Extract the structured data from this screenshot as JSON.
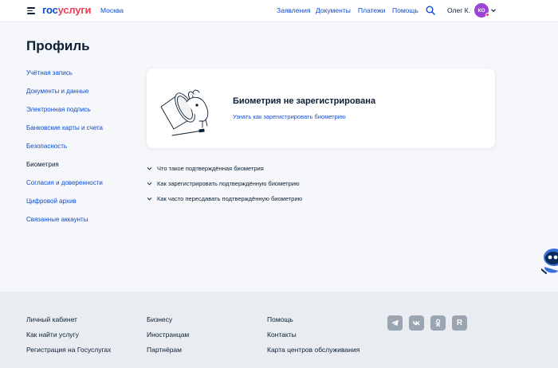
{
  "header": {
    "logo_gos": "гос",
    "logo_uslugi": "услуги",
    "city": "Москва",
    "nav": [
      "Заявления",
      "Документы",
      "Платежи",
      "Помощь"
    ],
    "user_name": "Олег К.",
    "avatar_initials": "КО"
  },
  "page": {
    "title": "Профиль"
  },
  "sidebar": {
    "items": [
      {
        "label": "Учётная запись"
      },
      {
        "label": "Документы и данные"
      },
      {
        "label": "Электронная подпись"
      },
      {
        "label": "Банковские карты и счета"
      },
      {
        "label": "Безопасность"
      },
      {
        "label": "Биометрия",
        "active": true
      },
      {
        "label": "Согласия и доверенности"
      },
      {
        "label": "Цифровой архив"
      },
      {
        "label": "Связанные аккаунты"
      }
    ]
  },
  "card": {
    "title": "Биометрия не зарегистрирована",
    "link": "Узнать как зарегистрировать биометрию"
  },
  "faq": [
    {
      "label": "Что такое подтверждённая биометрия"
    },
    {
      "label": "Как зарегистрировать подтверждённую биометрию"
    },
    {
      "label": "Как часто пересдавать подтверждённую биометрию"
    }
  ],
  "footer": {
    "col1": [
      "Личный кабинет",
      "Как найти услугу",
      "Регистрация на Госуслугах"
    ],
    "col2": [
      "Бизнесу",
      "Иностранцам",
      "Партнёрам"
    ],
    "col3": [
      "Помощь",
      "Контакты",
      "Карта центров обслуживания"
    ],
    "social": [
      {
        "icon": "telegram-icon"
      },
      {
        "icon": "vk-icon"
      },
      {
        "icon": "odnoklassniki-icon"
      },
      {
        "icon": "rutube-icon",
        "letter": "R"
      }
    ]
  },
  "colors": {
    "brand_blue": "#0d4cd3",
    "brand_red": "#ee3f58",
    "avatar_purple": "#9b45d8",
    "text_dark": "#0b1f33",
    "page_bg": "#f5f7fb",
    "footer_bg": "#e9edf2"
  }
}
